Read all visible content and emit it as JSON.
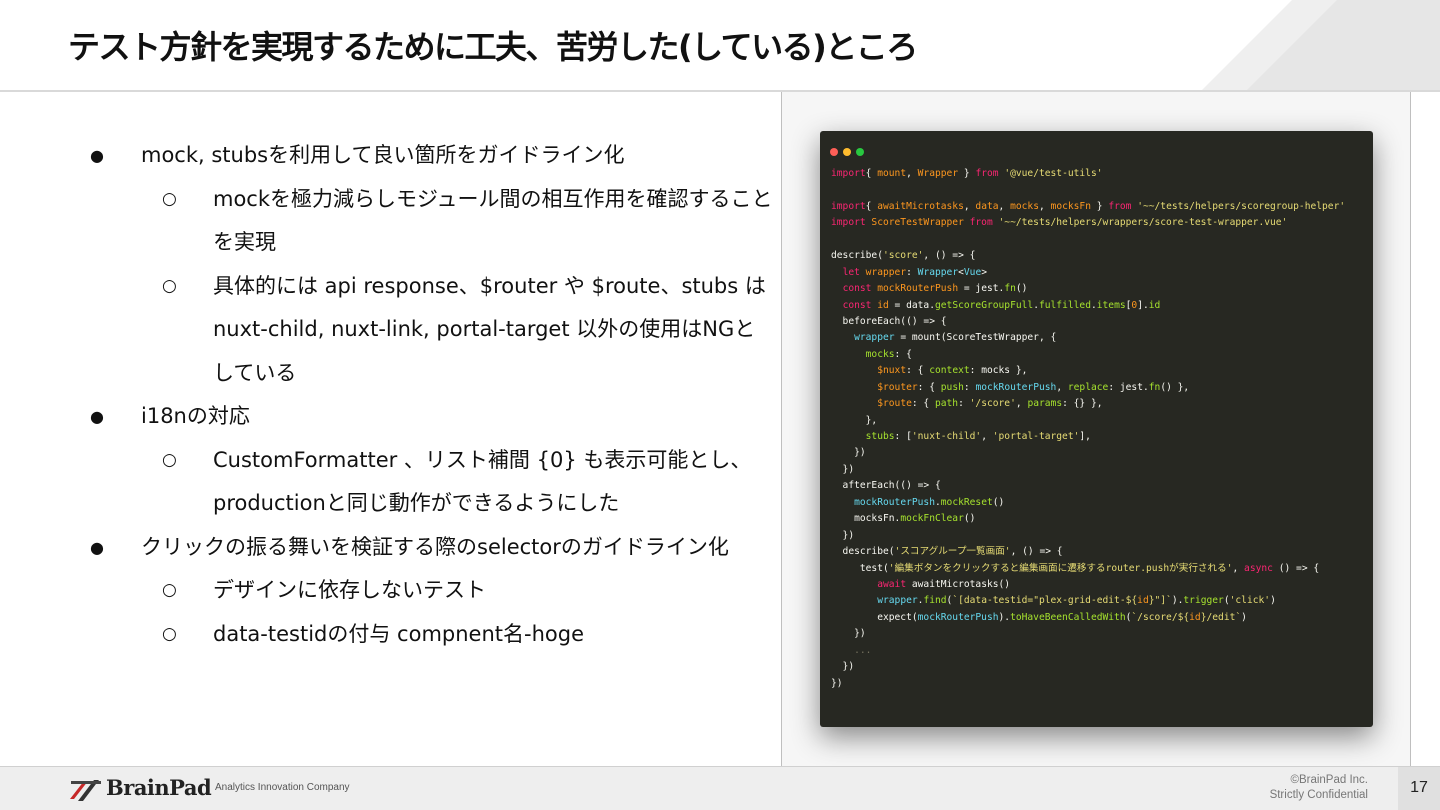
{
  "slide": {
    "title": "テスト方針を実現するために工夫、苦労した(している)ところ",
    "page_number": "17"
  },
  "bullets": [
    {
      "level": 1,
      "marker": "●",
      "text": "mock, stubsを利用して良い箇所をガイドライン化"
    },
    {
      "level": 2,
      "marker": "○",
      "text": "mockを極力減らしモジュール間の相互作用を確認することを実現"
    },
    {
      "level": 2,
      "marker": "○",
      "text": "具体的には api response、$router や $route、stubs はnuxt-child, nuxt-link, portal-target 以外の使用はNGとしている"
    },
    {
      "level": 1,
      "marker": "●",
      "text": "i18nの対応"
    },
    {
      "level": 2,
      "marker": "○",
      "text": "CustomFormatter 、リスト補間 {0} も表示可能とし、productionと同じ動作ができるようにした"
    },
    {
      "level": 1,
      "marker": "●",
      "text": "クリックの振る舞いを検証する際のselectorのガイドライン化"
    },
    {
      "level": 2,
      "marker": "○",
      "text": "デザインに依存しないテスト"
    },
    {
      "level": 2,
      "marker": "○",
      "text": "data-testidの付与 compnent名-hoge"
    }
  ],
  "code_window": {
    "dot_colors": [
      "#fe5f57",
      "#febc2e",
      "#28c840"
    ],
    "lines": [
      [
        [
          "kw",
          "import"
        ],
        [
          "",
          "{ "
        ],
        [
          "pr",
          "mount"
        ],
        [
          "",
          ", "
        ],
        [
          "pr",
          "Wrapper"
        ],
        [
          "",
          " } "
        ],
        [
          "kw",
          "from"
        ],
        [
          "",
          ""
        ],
        [
          "str",
          " '@vue/test-utils'"
        ]
      ],
      [],
      [
        [
          "kw",
          "import"
        ],
        [
          "",
          "{ "
        ],
        [
          "pr",
          "awaitMicrotasks"
        ],
        [
          "",
          ", "
        ],
        [
          "pr",
          "data"
        ],
        [
          "",
          ", "
        ],
        [
          "pr",
          "mocks"
        ],
        [
          "",
          ", "
        ],
        [
          "pr",
          "mocksFn"
        ],
        [
          "",
          " } "
        ],
        [
          "kw",
          "from"
        ],
        [
          "str",
          " '~~/tests/helpers/scoregroup-helper'"
        ]
      ],
      [
        [
          "kw",
          "import"
        ],
        [
          "pr",
          " ScoreTestWrapper"
        ],
        [
          "kw",
          " from"
        ],
        [
          "str",
          " '~~/tests/helpers/wrappers/score-test-wrapper.vue'"
        ]
      ],
      [],
      [
        [
          "",
          "describe("
        ],
        [
          "str",
          "'score'"
        ],
        [
          "",
          ", () => {"
        ]
      ],
      [
        [
          "",
          "  "
        ],
        [
          "kw",
          "let"
        ],
        [
          "pr",
          " wrapper"
        ],
        [
          "",
          ": "
        ],
        [
          "ty",
          "Wrapper"
        ],
        [
          "",
          "<"
        ],
        [
          "ty",
          "Vue"
        ],
        [
          "",
          ">"
        ]
      ],
      [
        [
          "",
          "  "
        ],
        [
          "kw",
          "const"
        ],
        [
          "pr",
          " mockRouterPush"
        ],
        [
          "",
          " = jest."
        ],
        [
          "fn",
          "fn"
        ],
        [
          "",
          "()"
        ]
      ],
      [
        [
          "",
          "  "
        ],
        [
          "kw",
          "const"
        ],
        [
          "pr",
          " id"
        ],
        [
          "",
          " = data."
        ],
        [
          "fn",
          "getScoreGroupFull"
        ],
        [
          "",
          "."
        ],
        [
          "fn",
          "fulfilled"
        ],
        [
          "",
          "."
        ],
        [
          "fn",
          "items"
        ],
        [
          "",
          "["
        ],
        [
          "pr",
          "0"
        ],
        [
          "",
          "]."
        ],
        [
          "fn",
          "id"
        ]
      ],
      [
        [
          "",
          "  beforeEach(() => {"
        ]
      ],
      [
        [
          "",
          "    "
        ],
        [
          "ty",
          "wrapper"
        ],
        [
          "",
          " = mount(ScoreTestWrapper, {"
        ]
      ],
      [
        [
          "",
          "      "
        ],
        [
          "fn",
          "mocks"
        ],
        [
          "",
          ": {"
        ]
      ],
      [
        [
          "",
          "        "
        ],
        [
          "pr",
          "$nuxt"
        ],
        [
          "",
          ": { "
        ],
        [
          "fn",
          "context"
        ],
        [
          "",
          ": mocks },"
        ]
      ],
      [
        [
          "",
          "        "
        ],
        [
          "pr",
          "$router"
        ],
        [
          "",
          ": { "
        ],
        [
          "fn",
          "push"
        ],
        [
          "",
          ": "
        ],
        [
          "ty",
          "mockRouterPush"
        ],
        [
          "",
          ", "
        ],
        [
          "fn",
          "replace"
        ],
        [
          "",
          ": jest."
        ],
        [
          "fn",
          "fn"
        ],
        [
          "",
          "() },"
        ]
      ],
      [
        [
          "",
          "        "
        ],
        [
          "pr",
          "$route"
        ],
        [
          "",
          ": { "
        ],
        [
          "fn",
          "path"
        ],
        [
          "",
          ": "
        ],
        [
          "str",
          "'/score'"
        ],
        [
          "",
          ", "
        ],
        [
          "fn",
          "params"
        ],
        [
          "",
          ": {} },"
        ]
      ],
      [
        [
          "",
          "      },"
        ]
      ],
      [
        [
          "",
          "      "
        ],
        [
          "fn",
          "stubs"
        ],
        [
          "",
          ": ["
        ],
        [
          "str",
          "'nuxt-child'"
        ],
        [
          "",
          ", "
        ],
        [
          "str",
          "'portal-target'"
        ],
        [
          "",
          "],"
        ]
      ],
      [
        [
          "",
          "    })"
        ]
      ],
      [
        [
          "",
          "  })"
        ]
      ],
      [
        [
          "",
          "  afterEach(() => {"
        ]
      ],
      [
        [
          "",
          "    "
        ],
        [
          "ty",
          "mockRouterPush"
        ],
        [
          "",
          "."
        ],
        [
          "fn",
          "mockReset"
        ],
        [
          "",
          "()"
        ]
      ],
      [
        [
          "",
          "    mocksFn."
        ],
        [
          "fn",
          "mockFnClear"
        ],
        [
          "",
          "()"
        ]
      ],
      [
        [
          "",
          "  })"
        ]
      ],
      [
        [
          "",
          "  describe("
        ],
        [
          "str",
          "'スコアグループ一覧画面'"
        ],
        [
          "",
          ", () => {"
        ]
      ],
      [
        [
          "",
          "     test("
        ],
        [
          "str",
          "'編集ボタンをクリックすると編集画面に遷移するrouter.pushが実行される'"
        ],
        [
          "",
          ", "
        ],
        [
          "kw",
          "async"
        ],
        [
          "",
          " () => {"
        ]
      ],
      [
        [
          "",
          "        "
        ],
        [
          "kw",
          "await"
        ],
        [
          "",
          " awaitMicrotasks()"
        ]
      ],
      [
        [
          "",
          "        "
        ],
        [
          "ty",
          "wrapper"
        ],
        [
          "",
          "."
        ],
        [
          "fn",
          "find"
        ],
        [
          "",
          "("
        ],
        [
          "str",
          "`[data-testid=\"plex-grid-edit-${"
        ],
        [
          "pr",
          "id"
        ],
        [
          "str",
          "}\"]`"
        ],
        [
          "",
          ")."
        ],
        [
          "fn",
          "trigger"
        ],
        [
          "",
          "("
        ],
        [
          "str",
          "'click'"
        ],
        [
          "",
          ")"
        ]
      ],
      [
        [
          "",
          "        expect("
        ],
        [
          "ty",
          "mockRouterPush"
        ],
        [
          "",
          ")."
        ],
        [
          "fn",
          "toHaveBeenCalledWith"
        ],
        [
          "",
          "("
        ],
        [
          "str",
          "`/score/${"
        ],
        [
          "pr",
          "id"
        ],
        [
          "str",
          "}/edit`"
        ],
        [
          "",
          ")"
        ]
      ],
      [
        [
          "",
          "    })"
        ]
      ],
      [
        [
          "cm",
          "    ..."
        ]
      ],
      [
        [
          "",
          "  })"
        ]
      ],
      [
        [
          "",
          "})"
        ]
      ]
    ]
  },
  "footer": {
    "logo_text": "BrainPad",
    "tagline": "Analytics Innovation Company",
    "copyright": "©BrainPad Inc.",
    "confidential": "Strictly Confidential"
  }
}
